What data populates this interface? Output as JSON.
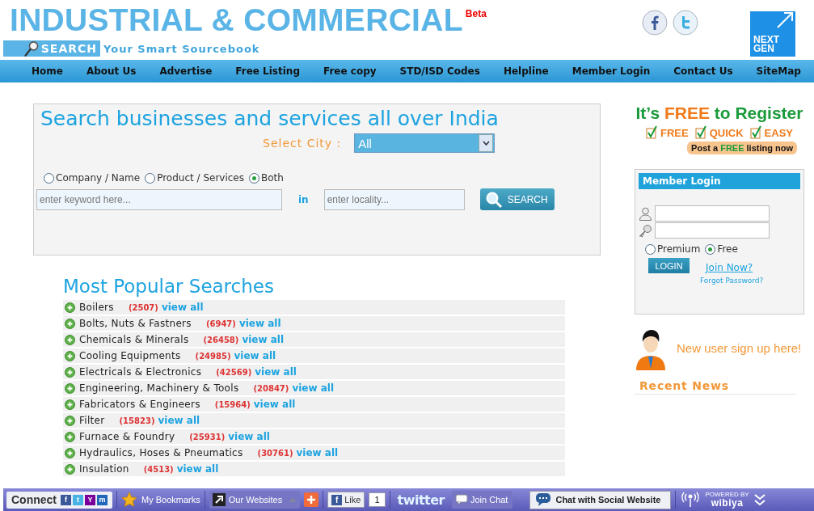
{
  "header": {
    "title": "INDUSTRIAL & COMMERCIAL",
    "beta": "Beta",
    "search_label": "SEARCH",
    "tagline": "Your Smart Sourcebook",
    "badge_lines": [
      "NEXT",
      "GEN"
    ]
  },
  "nav": [
    "Home",
    "About Us",
    "Advertise",
    "Free Listing",
    "Free copy",
    "STD/ISD Codes",
    "Helpline",
    "Member Login",
    "Contact Us",
    "SiteMap"
  ],
  "search": {
    "title": "Search businesses and services all over India",
    "city_label": "Select City :",
    "city_value": "All",
    "modes": [
      {
        "label": "Company / Name",
        "selected": false
      },
      {
        "label": "Product / Services",
        "selected": false
      },
      {
        "label": "Both",
        "selected": true
      }
    ],
    "keyword_placeholder": "enter keyword here...",
    "in_label": "in",
    "locality_placeholder": "enter locality...",
    "button": "SEARCH"
  },
  "popular": {
    "title": "Most Popular Searches",
    "rows": [
      {
        "name": "Boilers",
        "count": "(2507)",
        "link": "view all"
      },
      {
        "name": "Bolts, Nuts & Fastners",
        "count": "(6947)",
        "link": "view all"
      },
      {
        "name": "Chemicals & Minerals",
        "count": "(26458)",
        "link": "view all"
      },
      {
        "name": "Cooling Equipments",
        "count": "(24985)",
        "link": "view all"
      },
      {
        "name": "Electricals & Electronics",
        "count": "(42569)",
        "link": "view all"
      },
      {
        "name": "Engineering, Machinery & Tools",
        "count": "(20847)",
        "link": "view all"
      },
      {
        "name": "Fabricators & Engineers",
        "count": "(15964)",
        "link": "view all"
      },
      {
        "name": "Filter",
        "count": "(15823)",
        "link": "view all"
      },
      {
        "name": "Furnace & Foundry",
        "count": "(25931)",
        "link": "view all"
      },
      {
        "name": "Hydraulics, Hoses & Pneumatics",
        "count": "(30761)",
        "link": "view all"
      },
      {
        "name": "Insulation",
        "count": "(4513)",
        "link": "view all"
      }
    ]
  },
  "register": {
    "title": "It’s **FREE** to Register",
    "checks": [
      {
        "label": "FREE",
        "checked": true
      },
      {
        "label": "QUICK",
        "checked": true
      },
      {
        "label": "EASY",
        "checked": true
      }
    ],
    "post_button": "Post a **FREE** listing now"
  },
  "login": {
    "title": "Member Login",
    "types": [
      {
        "label": "Premium",
        "selected": false
      },
      {
        "label": "Free",
        "selected": true
      }
    ],
    "button": "LOGIN",
    "join": "Join Now?",
    "forgot": "Forgot Password?"
  },
  "signup": "New user sign up here!",
  "recent_news": "Recent News",
  "toolbar": {
    "connect": "Connect",
    "networks": [
      "f",
      "t",
      "Y",
      "m"
    ],
    "like_icon": "f",
    "bookmarks": "My Bookmarks",
    "websites": "Our Websites",
    "like": "Like",
    "like_count": "1",
    "twitter": "twitter",
    "join_chat": "Join Chat",
    "chat": "Chat with Social Website",
    "powered_by": "POWERED BY",
    "brand": "wibiya"
  }
}
